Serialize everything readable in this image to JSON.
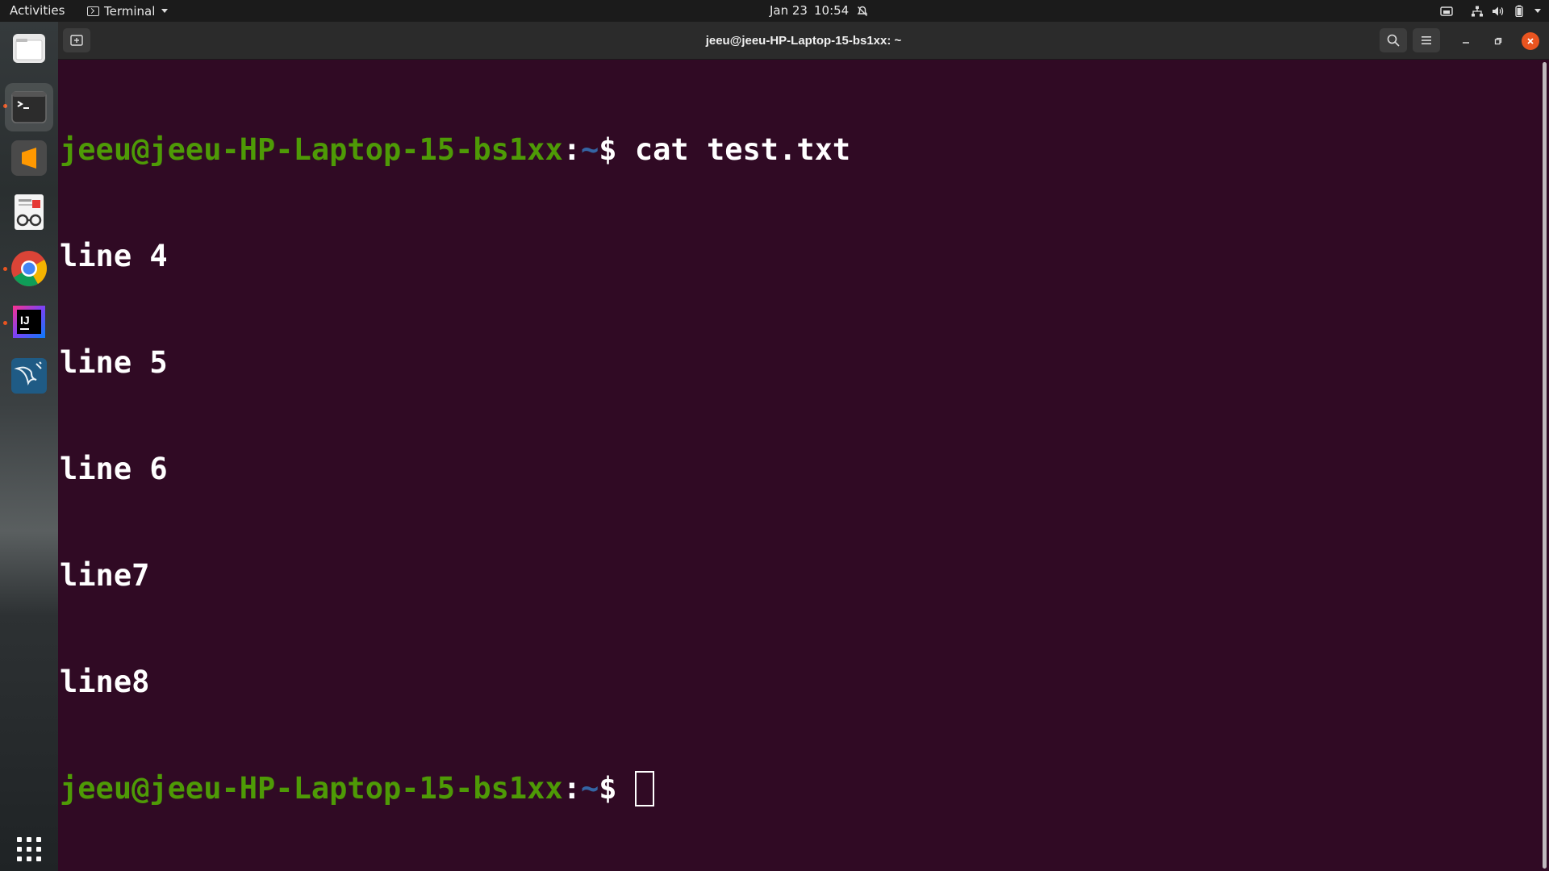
{
  "topbar": {
    "activities": "Activities",
    "app_name": "Terminal",
    "date": "Jan 23",
    "time": "10:54"
  },
  "dock": {
    "items": [
      {
        "name": "files",
        "icon": "folder-icon",
        "running": false
      },
      {
        "name": "terminal",
        "icon": "terminal-icon",
        "running": true,
        "active": true
      },
      {
        "name": "sublime-text",
        "icon": "sublime-icon",
        "running": false
      },
      {
        "name": "document-viewer",
        "icon": "reader-icon",
        "running": false
      },
      {
        "name": "chrome",
        "icon": "chrome-icon",
        "running": true
      },
      {
        "name": "intellij-idea",
        "icon": "intellij-icon",
        "running": true
      },
      {
        "name": "mysql-workbench",
        "icon": "dolphin-icon",
        "running": false
      }
    ],
    "grid_icon": "app-grid-icon"
  },
  "window": {
    "title": "jeeu@jeeu-HP-Laptop-15-bs1xx: ~"
  },
  "terminal": {
    "prompt_user": "jeeu@jeeu-HP-Laptop-15-bs1xx",
    "prompt_sep": ":",
    "prompt_path": "~",
    "prompt_symbol": "$ ",
    "command": "cat test.txt",
    "output": [
      "line 4",
      "line 5",
      "line 6",
      "line7",
      "line8"
    ]
  },
  "colors": {
    "terminal_bg": "#300a24",
    "prompt_user": "#4e9a06",
    "prompt_path": "#3465a4",
    "accent": "#e95420"
  }
}
